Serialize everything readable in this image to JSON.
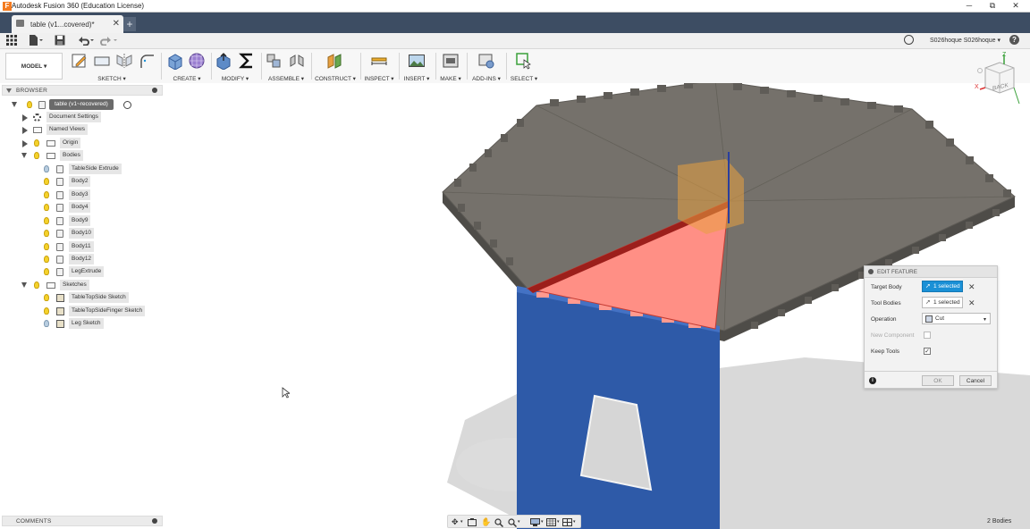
{
  "window": {
    "title": "Autodesk Fusion 360 (Education License)",
    "minimize": "─",
    "restore": "⧉",
    "close": "✕"
  },
  "tab": {
    "label": "table (v1...covered)*",
    "close": "✕",
    "new_tab": "+"
  },
  "qat": {
    "user": "S026hoque S026hoque ▾",
    "help": "?"
  },
  "ribbon": {
    "workspace": "MODEL ▾",
    "groups": [
      "SKETCH ▾",
      "CREATE ▾",
      "MODIFY ▾",
      "ASSEMBLE ▾",
      "CONSTRUCT ▾",
      "INSPECT ▾",
      "INSERT ▾",
      "MAKE ▾",
      "ADD-INS ▾",
      "SELECT ▾"
    ]
  },
  "browser": {
    "title": "BROWSER",
    "root": "table (v1~recovered)",
    "items": {
      "doc_settings": "Document Settings",
      "named_views": "Named Views",
      "origin": "Origin",
      "bodies": "Bodies",
      "body_list": [
        "TableSide Extrude",
        "Body2",
        "Body3",
        "Body4",
        "Body9",
        "Body10",
        "Body11",
        "Body12",
        "LegExtrude"
      ],
      "sketches": "Sketches",
      "sketch_list": [
        "TableTopSide Sketch",
        "TableTopSideFinger Sketch",
        "Leg Sketch"
      ]
    }
  },
  "comments": {
    "title": "COMMENTS"
  },
  "viewcube": {
    "face": "BACK",
    "z": "Z",
    "x": "X"
  },
  "edit_feature": {
    "title": "EDIT FEATURE",
    "target_body_label": "Target Body",
    "target_body_value": "1 selected",
    "tool_bodies_label": "Tool Bodies",
    "tool_bodies_value": "1 selected",
    "operation_label": "Operation",
    "operation_value": "Cut",
    "new_component_label": "New Component",
    "keep_tools_label": "Keep Tools",
    "keep_tools_checked": "✓",
    "info": "i",
    "ok": "OK",
    "cancel": "Cancel"
  },
  "status": {
    "bodies": "2 Bodies"
  },
  "colors": {
    "tabbar": "#3d4d63",
    "accent_blue": "#1a90d6",
    "table_top": "#75716b",
    "leg_blue": "#2e5aa8",
    "cut_red": "#ff8f85"
  }
}
